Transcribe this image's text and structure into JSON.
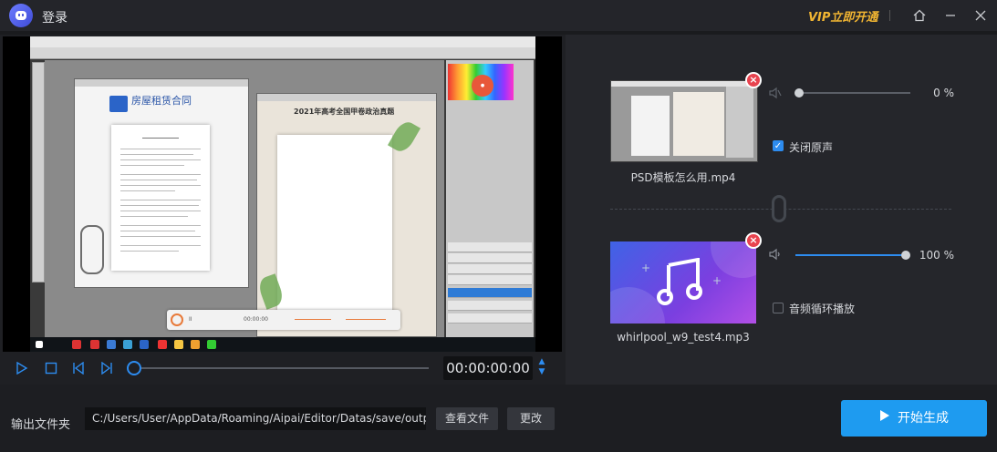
{
  "titlebar": {
    "login_label": "登录",
    "vip_label": "VIP立即开通",
    "home_icon": "home-icon",
    "minimize_icon": "minimize-icon",
    "close_icon": "close-icon"
  },
  "preview": {
    "doc1_title": "房屋租赁合同",
    "doc2_title": "2021年高考全国甲卷政治真题"
  },
  "player": {
    "time": "00:00:00:00",
    "progress": 0
  },
  "video_track": {
    "filename": "PSD模板怎么用.mp4",
    "volume_label": "0 %",
    "volume": 0,
    "mute_original_label": "关闭原声",
    "mute_original_checked": true
  },
  "audio_track": {
    "filename": "whirlpool_w9_test4.mp3",
    "volume_label": "100 %",
    "volume": 100,
    "loop_label": "音频循环播放",
    "loop_checked": false
  },
  "output": {
    "label": "输出文件夹",
    "path": "C:/Users/User/AppData/Roaming/Aipai/Editor/Datas/save/output",
    "view_button": "查看文件",
    "change_button": "更改",
    "start_button": "开始生成"
  },
  "colors": {
    "accent": "#1e9bf0",
    "vip": "#f1b532",
    "delete_badge": "#e8434f"
  }
}
